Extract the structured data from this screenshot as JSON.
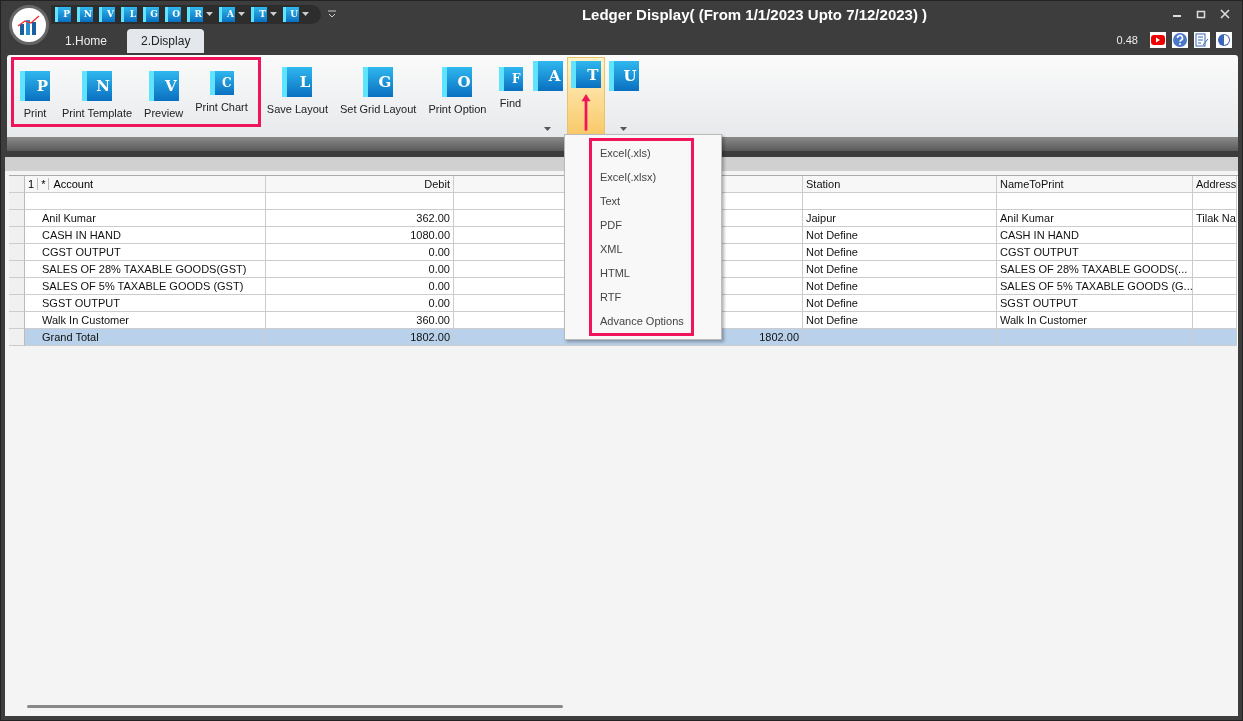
{
  "window": {
    "title": "Ledger Display( (From 1/1/2023 Upto 7/12/2023) )"
  },
  "quick_access": [
    {
      "letter": "P",
      "dropdown": false
    },
    {
      "letter": "N",
      "dropdown": false
    },
    {
      "letter": "V",
      "dropdown": false
    },
    {
      "letter": "L",
      "dropdown": false
    },
    {
      "letter": "G",
      "dropdown": false
    },
    {
      "letter": "O",
      "dropdown": false
    },
    {
      "letter": "R",
      "dropdown": true
    },
    {
      "letter": "A",
      "dropdown": true
    },
    {
      "letter": "T",
      "dropdown": true
    },
    {
      "letter": "U",
      "dropdown": true
    }
  ],
  "tabs": [
    {
      "label": "1.Home",
      "selected": false
    },
    {
      "label": "2.Display",
      "selected": true
    }
  ],
  "status": {
    "value": "0.48"
  },
  "ribbon": [
    {
      "letter": "P",
      "label": "Print",
      "dropdown": false,
      "selected": false
    },
    {
      "letter": "N",
      "label": "Print Template",
      "dropdown": false,
      "selected": false
    },
    {
      "letter": "V",
      "label": "Preview",
      "dropdown": false,
      "selected": false
    },
    {
      "letter": "C",
      "label": "Print Chart",
      "dropdown": false,
      "selected": false
    },
    {
      "letter": "L",
      "label": "Save Layout",
      "dropdown": false,
      "selected": false
    },
    {
      "letter": "G",
      "label": "Set Grid Layout",
      "dropdown": false,
      "selected": false
    },
    {
      "letter": "O",
      "label": "Print Option",
      "dropdown": false,
      "selected": false
    },
    {
      "letter": "F",
      "label": "Find",
      "dropdown": false,
      "selected": false
    },
    {
      "letter": "A",
      "dropdown": true,
      "selected": false
    },
    {
      "letter": "T",
      "dropdown": true,
      "selected": true
    },
    {
      "letter": "U",
      "dropdown": true,
      "selected": false
    }
  ],
  "export_menu": [
    "Excel(.xls)",
    "Excel(.xlsx)",
    "Text",
    "PDF",
    "XML",
    "HTML",
    "RTF",
    "Advance Options"
  ],
  "grid": {
    "header_marks": [
      "1",
      "*"
    ],
    "columns": [
      {
        "label": "Account"
      },
      {
        "label": "Debit"
      },
      {},
      {
        "label": "Station"
      },
      {
        "label": "NameToPrint"
      },
      {
        "label": "Address"
      }
    ],
    "rows": [
      {
        "kind": "data",
        "cells": [
          "Anil Kumar",
          "362.00",
          null,
          "Jaipur",
          "Anil Kumar",
          "Tilak Na"
        ]
      },
      {
        "kind": "data",
        "cells": [
          "CASH IN HAND",
          "1080.00",
          null,
          "Not Define",
          "CASH IN HAND",
          null
        ]
      },
      {
        "kind": "data",
        "cells": [
          "CGST OUTPUT",
          "0.00",
          null,
          "Not Define",
          "CGST OUTPUT",
          null
        ]
      },
      {
        "kind": "data",
        "cells": [
          "SALES OF 28% TAXABLE GOODS(GST)",
          "0.00",
          null,
          "Not Define",
          "SALES OF 28% TAXABLE GOODS(...",
          null
        ]
      },
      {
        "kind": "data",
        "cells": [
          "SALES OF 5% TAXABLE GOODS (GST)",
          "0.00",
          null,
          "Not Define",
          "SALES OF 5% TAXABLE GOODS (G...",
          null
        ]
      },
      {
        "kind": "data",
        "cells": [
          "SGST OUTPUT",
          "0.00",
          null,
          "Not Define",
          "SGST OUTPUT",
          null
        ]
      },
      {
        "kind": "data",
        "cells": [
          "Walk In Customer",
          "360.00",
          null,
          "Not Define",
          "Walk In Customer",
          null
        ]
      },
      {
        "kind": "total",
        "cells": [
          "Grand Total",
          "1802.00",
          "1802.00",
          null,
          null,
          null
        ]
      }
    ]
  }
}
